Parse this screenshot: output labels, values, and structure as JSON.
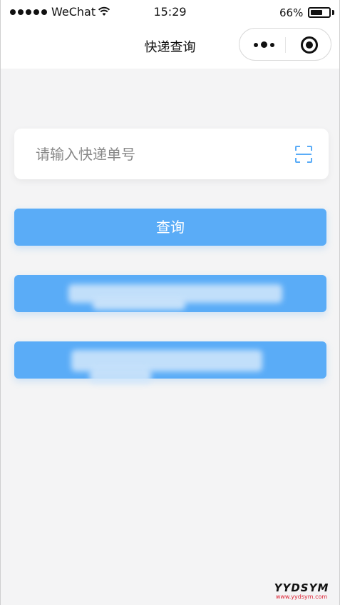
{
  "status_bar": {
    "carrier": "WeChat",
    "time": "15:29",
    "battery_percent": "66%",
    "battery_level": 0.66
  },
  "nav": {
    "title": "快递查询",
    "more_icon": "more-dots-icon",
    "close_icon": "close-target-icon"
  },
  "search": {
    "placeholder": "请输入快递单号",
    "value": "",
    "scan_icon": "scan-icon"
  },
  "buttons": {
    "query_label": "查询",
    "second_label": "",
    "third_label": ""
  },
  "colors": {
    "accent": "#5aacf7",
    "background": "#f4f4f5",
    "card": "#ffffff"
  },
  "watermark": {
    "main": "YYDSYM",
    "sub": "www.yydsym.com"
  }
}
